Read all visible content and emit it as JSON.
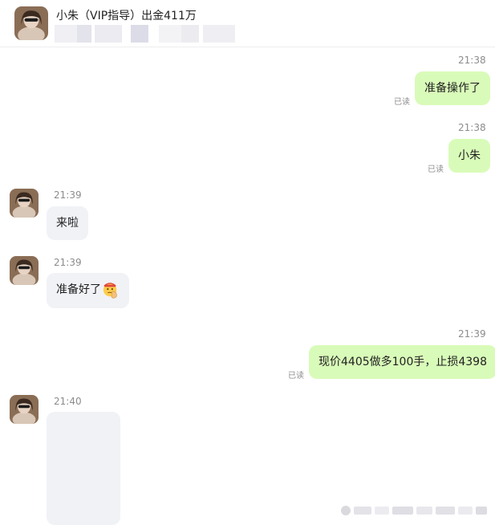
{
  "contact": {
    "name": "小朱（VIP指导）出金411万"
  },
  "messages": [
    {
      "direction": "out",
      "time": "21:38",
      "text": "准备操作了",
      "status": "已读"
    },
    {
      "direction": "out",
      "time": "21:38",
      "text": "小朱",
      "status": "已读"
    },
    {
      "direction": "in",
      "time": "21:39",
      "text": "来啦"
    },
    {
      "direction": "in",
      "time": "21:39",
      "text": "准备好了",
      "emoji": "thinking-salute-emoji"
    },
    {
      "direction": "out",
      "time": "21:39",
      "text": "现价4405做多100手，止损4398",
      "status": "已读"
    },
    {
      "direction": "in",
      "time": "21:40",
      "attachment": "image"
    }
  ],
  "colors": {
    "outgoing_bubble": "#d9fbb9",
    "incoming_bubble": "#f1f2f6",
    "timestamp": "#8c8c8c"
  }
}
